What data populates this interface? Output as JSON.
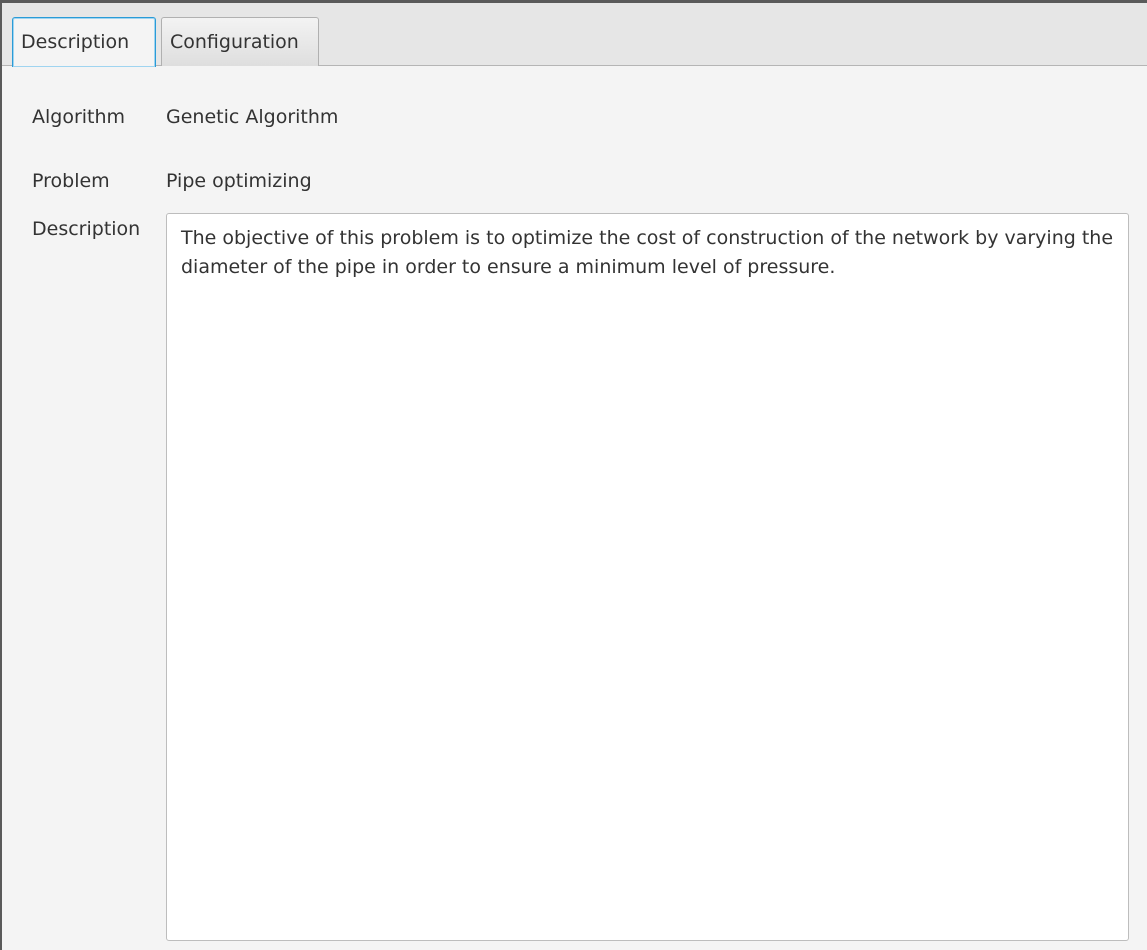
{
  "tabs": [
    {
      "label": "Description",
      "selected": true
    },
    {
      "label": "Configuration",
      "selected": false
    }
  ],
  "fields": {
    "algorithm": {
      "label": "Algorithm",
      "value": "Genetic Algorithm"
    },
    "problem": {
      "label": "Problem",
      "value": "Pipe optimizing"
    },
    "description": {
      "label": "Description",
      "value": "The objective of this problem is to optimize the cost of construction of the network by varying the diameter of the pipe in order to ensure a minimum level of pressure."
    }
  },
  "colors": {
    "selected_tab_border": "#2a9bd7",
    "background": "#f4f4f4",
    "text": "#333333"
  }
}
